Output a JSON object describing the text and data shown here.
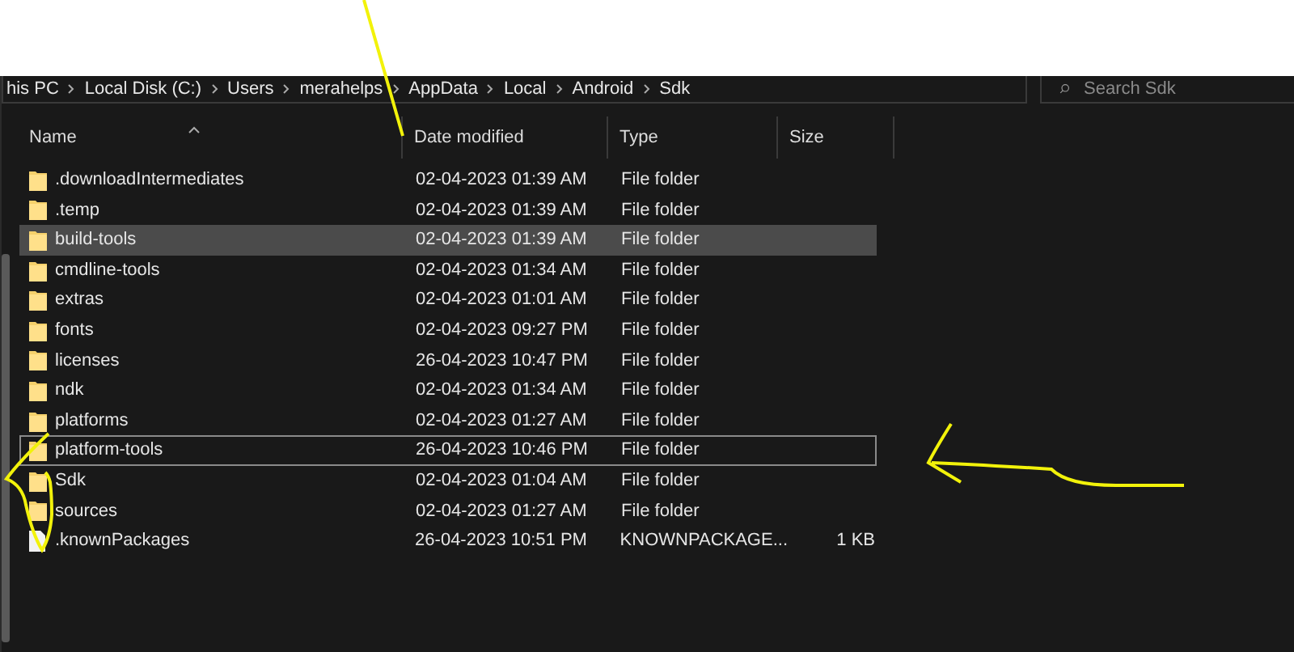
{
  "address_bar": {
    "path": [
      "his PC",
      "Local Disk (C:)",
      "Users",
      "merahelps",
      "AppData",
      "Local",
      "Android",
      "Sdk"
    ]
  },
  "search": {
    "placeholder": "Search Sdk"
  },
  "columns": [
    "Name",
    "Date modified",
    "Type",
    "Size"
  ],
  "rows": [
    {
      "kind": "folder",
      "name": ".downloadIntermediates",
      "date": "02-04-2023 01:39 AM",
      "type": "File folder",
      "selected": false,
      "focused": false
    },
    {
      "kind": "folder",
      "name": ".temp",
      "date": "02-04-2023 01:39 AM",
      "type": "File folder",
      "selected": false,
      "focused": false
    },
    {
      "kind": "folder",
      "name": "build-tools",
      "date": "02-04-2023 01:39 AM",
      "type": "File folder",
      "selected": true,
      "focused": false
    },
    {
      "kind": "folder",
      "name": "cmdline-tools",
      "date": "02-04-2023 01:34 AM",
      "type": "File folder",
      "selected": false,
      "focused": false
    },
    {
      "kind": "folder",
      "name": "extras",
      "date": "02-04-2023 01:01 AM",
      "type": "File folder",
      "selected": false,
      "focused": false
    },
    {
      "kind": "folder",
      "name": "fonts",
      "date": "02-04-2023 09:27 PM",
      "type": "File folder",
      "selected": false,
      "focused": false
    },
    {
      "kind": "folder",
      "name": "licenses",
      "date": "26-04-2023 10:47 PM",
      "type": "File folder",
      "selected": false,
      "focused": false
    },
    {
      "kind": "folder",
      "name": "ndk",
      "date": "02-04-2023 01:34 AM",
      "type": "File folder",
      "selected": false,
      "focused": false
    },
    {
      "kind": "folder",
      "name": "platforms",
      "date": "02-04-2023 01:27 AM",
      "type": "File folder",
      "selected": false,
      "focused": false
    },
    {
      "kind": "folder",
      "name": "platform-tools",
      "date": "26-04-2023 10:46 PM",
      "type": "File folder",
      "selected": false,
      "focused": true
    },
    {
      "kind": "folder",
      "name": "Sdk",
      "date": "02-04-2023 01:04 AM",
      "type": "File folder",
      "selected": false,
      "focused": false
    },
    {
      "kind": "folder",
      "name": "sources",
      "date": "02-04-2023 01:27 AM",
      "type": "File folder",
      "selected": false,
      "focused": false
    },
    {
      "kind": "file",
      "name": ".knownPackages",
      "date": "26-04-2023 10:51 PM",
      "type": "KNOWNPACKAGE...",
      "size": "1 KB",
      "selected": false,
      "focused": false
    }
  ]
}
